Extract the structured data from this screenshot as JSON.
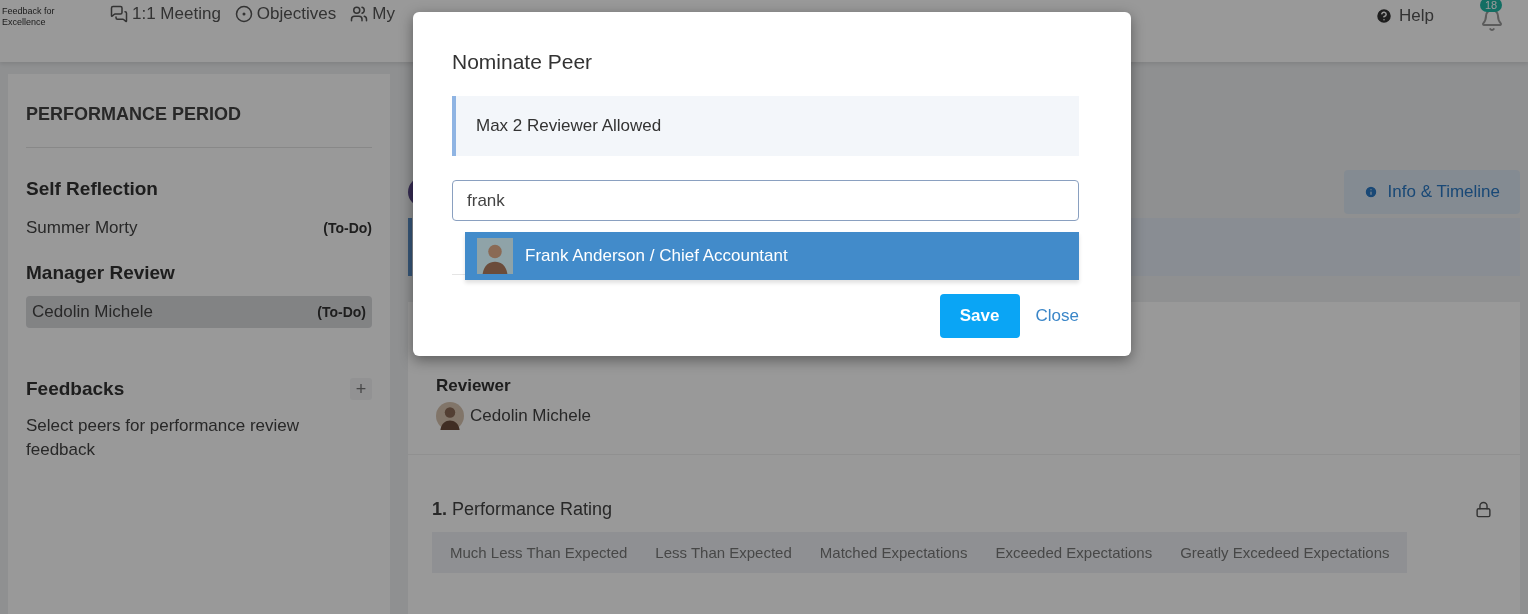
{
  "nav": {
    "logo_text": "Feedback for Excellence",
    "items": [
      {
        "label": "1:1 Meeting"
      },
      {
        "label": "Objectives"
      },
      {
        "label": "My"
      }
    ],
    "help": "Help",
    "notification_count": "18"
  },
  "sidebar": {
    "title": "PERFORMANCE PERIOD",
    "sections": [
      {
        "heading": "Self Reflection",
        "items": [
          {
            "name": "Summer Morty",
            "status": "(To-Do)",
            "selected": false
          }
        ]
      },
      {
        "heading": "Manager Review",
        "items": [
          {
            "name": "Cedolin Michele",
            "status": "(To-Do)",
            "selected": true
          }
        ]
      }
    ],
    "feedbacks": {
      "heading": "Feedbacks",
      "add": "+",
      "hint": "Select peers for performance review feedback"
    }
  },
  "main": {
    "info_button": "Info & Timeline",
    "reviewer_label": "Reviewer",
    "reviewer_name": "Cedolin Michele",
    "question": {
      "number": "1.",
      "title": "Performance Rating",
      "locked": true,
      "options": [
        "Much Less Than Expected",
        "Less Than Expected",
        "Matched Expectations",
        "Exceeded Expectations",
        "Greatly Excedeed Expectations"
      ]
    }
  },
  "modal": {
    "title": "Nominate Peer",
    "notice": "Max 2 Reviewer Allowed",
    "search_value": "frank",
    "results": [
      {
        "label": "Frank Anderson / Chief Accountant",
        "selected": true
      }
    ],
    "save": "Save",
    "close": "Close"
  }
}
